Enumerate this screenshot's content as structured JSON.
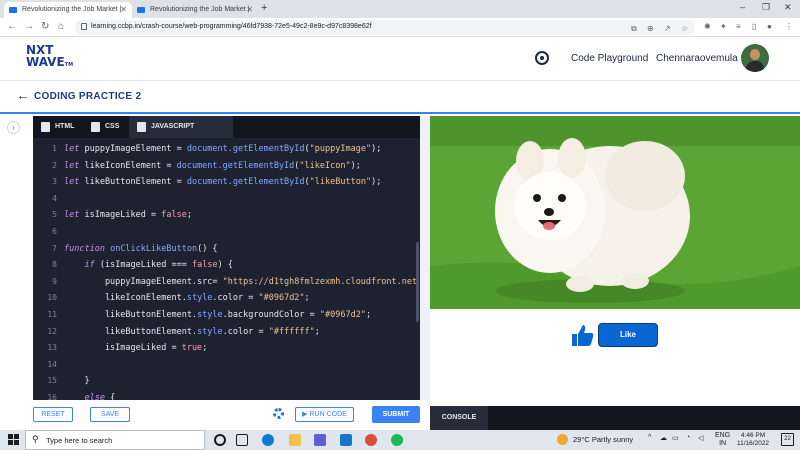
{
  "browser": {
    "tabs": [
      {
        "title": "Revolutionizing the Job Market |",
        "active": true
      },
      {
        "title": "Revolutionizing the Job Market |",
        "active": false
      }
    ],
    "new_tab_label": "+",
    "url": "learning.ccbp.in/crash-course/web-programming/46fd7938-72e5-49c2-8e9c-d97c8398e62f",
    "window_controls": [
      "–",
      "❐",
      "✕"
    ]
  },
  "header": {
    "logo_line1": "NXT",
    "logo_line2": "WAVE",
    "logo_tm": "TM",
    "code_playground": "Code Playground",
    "username": "Chennaraovemula"
  },
  "practice": {
    "back_icon": "←",
    "title": "CODING PRACTICE 2",
    "expand_icon": "›"
  },
  "editor": {
    "tabs": [
      {
        "label": "HTML",
        "active": false
      },
      {
        "label": "CSS",
        "active": false
      },
      {
        "label": "JAVASCRIPT",
        "active": true
      }
    ],
    "line_numbers": [
      "1",
      "2",
      "3",
      "4",
      "5",
      "6",
      "7",
      "8",
      "9",
      "10",
      "11",
      "12",
      "13",
      "14",
      "15",
      "16"
    ],
    "lines": [
      [
        {
          "t": "kw",
          "v": "let"
        },
        {
          "t": "",
          "v": " puppyImageElement = "
        },
        {
          "t": "fn",
          "v": "document.getElementById"
        },
        {
          "t": "",
          "v": "("
        },
        {
          "t": "str",
          "v": "\"puppyImage\""
        },
        {
          "t": "",
          "v": ");"
        }
      ],
      [
        {
          "t": "kw",
          "v": "let"
        },
        {
          "t": "",
          "v": " likeIconElement = "
        },
        {
          "t": "fn",
          "v": "document.getElementById"
        },
        {
          "t": "",
          "v": "("
        },
        {
          "t": "str",
          "v": "\"likeIcon\""
        },
        {
          "t": "",
          "v": ");"
        }
      ],
      [
        {
          "t": "kw",
          "v": "let"
        },
        {
          "t": "",
          "v": " likeButtonElement = "
        },
        {
          "t": "fn",
          "v": "document.getElementById"
        },
        {
          "t": "",
          "v": "("
        },
        {
          "t": "str",
          "v": "\"likeButton\""
        },
        {
          "t": "",
          "v": ");"
        }
      ],
      [],
      [
        {
          "t": "kw",
          "v": "let"
        },
        {
          "t": "",
          "v": " isImageLiked = "
        },
        {
          "t": "bool",
          "v": "false"
        },
        {
          "t": "",
          "v": ";"
        }
      ],
      [],
      [
        {
          "t": "kw",
          "v": "function"
        },
        {
          "t": "",
          "v": " "
        },
        {
          "t": "fn",
          "v": "onClickLikeButton"
        },
        {
          "t": "",
          "v": "() {"
        }
      ],
      [
        {
          "t": "",
          "v": "    "
        },
        {
          "t": "kw",
          "v": "if"
        },
        {
          "t": "",
          "v": " (isImageLiked === "
        },
        {
          "t": "bool",
          "v": "false"
        },
        {
          "t": "",
          "v": ") {"
        }
      ],
      [
        {
          "t": "",
          "v": "        puppyImageElement.src= "
        },
        {
          "t": "str",
          "v": "\"https://d1tgh8fmlzexmh.cloudfront.net"
        }
      ],
      [
        {
          "t": "",
          "v": "        likeIconElement."
        },
        {
          "t": "fn",
          "v": "style"
        },
        {
          "t": "",
          "v": ".color = "
        },
        {
          "t": "str",
          "v": "\"#0967d2\""
        },
        {
          "t": "",
          "v": ";"
        }
      ],
      [
        {
          "t": "",
          "v": "        likeButtonElement."
        },
        {
          "t": "fn",
          "v": "style"
        },
        {
          "t": "",
          "v": ".backgroundColor = "
        },
        {
          "t": "str",
          "v": "\"#0967d2\""
        },
        {
          "t": "",
          "v": ";"
        }
      ],
      [
        {
          "t": "",
          "v": "        likeButtonElement."
        },
        {
          "t": "fn",
          "v": "style"
        },
        {
          "t": "",
          "v": ".color = "
        },
        {
          "t": "str",
          "v": "\"#ffffff\""
        },
        {
          "t": "",
          "v": ";"
        }
      ],
      [
        {
          "t": "",
          "v": "        isImageLiked = "
        },
        {
          "t": "bool",
          "v": "true"
        },
        {
          "t": "",
          "v": ";"
        }
      ],
      [],
      [
        {
          "t": "",
          "v": "    }"
        }
      ],
      [
        {
          "t": "",
          "v": "    "
        },
        {
          "t": "kw",
          "v": "else"
        },
        {
          "t": "",
          "v": " {"
        }
      ]
    ],
    "reset_label": "RESET",
    "save_label": "SAVE",
    "run_label": "▶ RUN CODE",
    "submit_label": "SUBMIT"
  },
  "preview": {
    "like_button_label": "Like",
    "like_color": "#0967d2"
  },
  "console": {
    "tab_label": "CONSOLE"
  },
  "taskbar": {
    "search_placeholder": "Type here to search",
    "weather": "29°C  Partly sunny",
    "lang_line1": "ENG",
    "lang_line2": "IN",
    "time": "4:46 PM",
    "date": "11/16/2022",
    "notification_count": "22"
  },
  "colors": {
    "accent": "#3b82f6",
    "brand": "#1e3a8a",
    "editor_bg": "#1e2230"
  }
}
